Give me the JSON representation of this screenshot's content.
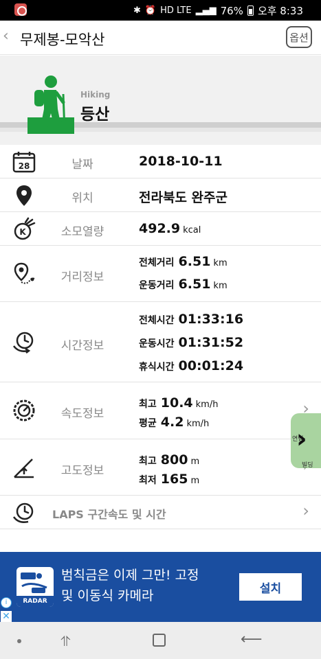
{
  "status_bar": {
    "battery": "76%",
    "time": "오후 8:33",
    "icons_text": "HD LTE"
  },
  "header": {
    "back_glyph": "‹",
    "title": "무제봉-모악산",
    "option_label": "옵션"
  },
  "hero": {
    "sub": "Hiking",
    "title": "등산"
  },
  "rows": {
    "date": {
      "label": "날짜",
      "value": "2018-10-11",
      "icon_day": "28"
    },
    "location": {
      "label": "위치",
      "value": "전라북도 완주군"
    },
    "calories": {
      "label": "소모열량",
      "value": "492.9",
      "unit": "kcal"
    },
    "distance": {
      "label": "거리정보",
      "total_key": "전체거리",
      "total_value": "6.51",
      "total_unit": "km",
      "move_key": "운동거리",
      "move_value": "6.51",
      "move_unit": "km"
    },
    "time": {
      "label": "시간정보",
      "total_key": "전체시간",
      "total_value": "01:33:16",
      "move_key": "운동시간",
      "move_value": "01:31:52",
      "rest_key": "휴식시간",
      "rest_value": "00:01:24"
    },
    "speed": {
      "label": "속도정보",
      "max_key": "최고",
      "max_value": "10.4",
      "max_unit": "km/h",
      "avg_key": "평균",
      "avg_value": "4.2",
      "avg_unit": "km/h"
    },
    "altitude": {
      "label": "고도정보",
      "max_key": "최고",
      "max_value": "800",
      "max_unit": "m",
      "min_key": "최저",
      "min_value": "165",
      "min_unit": "m"
    },
    "laps": {
      "label": "LAPS 구간속도 및 시간"
    }
  },
  "side_widget": {
    "tag_a": "연립",
    "tag_b": "빌딩"
  },
  "ad": {
    "line1": "범칙금은 이제 그만! 고정",
    "line2": "및 이동식 카메라",
    "install": "설치",
    "logo_text": "RADAR"
  },
  "colors": {
    "ad_blue": "#1a4ea0",
    "hiker_green": "#1e9e3e"
  }
}
